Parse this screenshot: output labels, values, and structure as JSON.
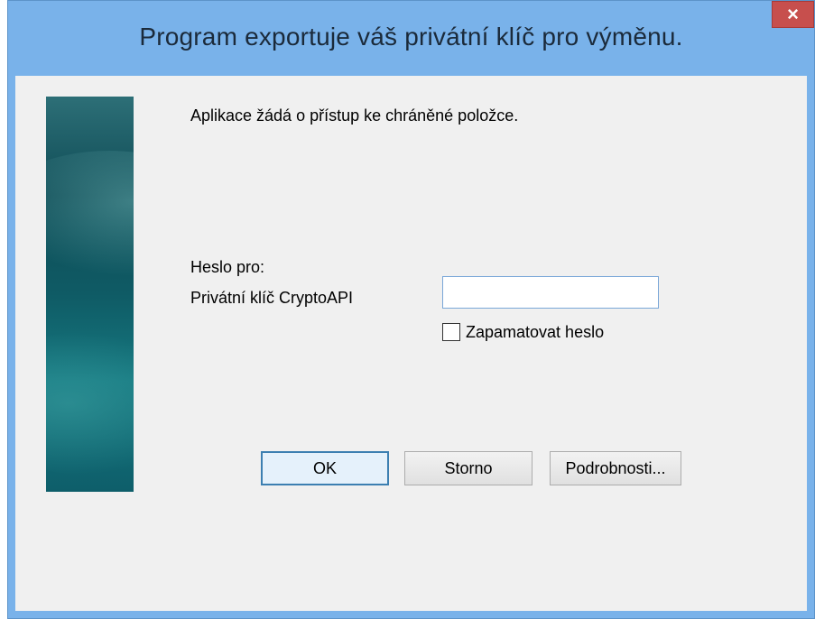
{
  "window": {
    "title": "Program exportuje váš privátní klíč pro výměnu.",
    "close_icon": "×"
  },
  "dialog": {
    "request_text": "Aplikace žádá o přístup ke chráněné položce.",
    "password_for_label": "Heslo pro:",
    "key_name": "Privátní klíč CryptoAPI",
    "password_value": "",
    "remember_label": "Zapamatovat heslo",
    "remember_checked": false
  },
  "buttons": {
    "ok": "OK",
    "cancel": "Storno",
    "details": "Podrobnosti..."
  },
  "colors": {
    "title_bar": "#79b2ea",
    "close_button": "#c74f4d",
    "client_background": "#f0f0f0",
    "default_button_border": "#3c7fb1"
  }
}
